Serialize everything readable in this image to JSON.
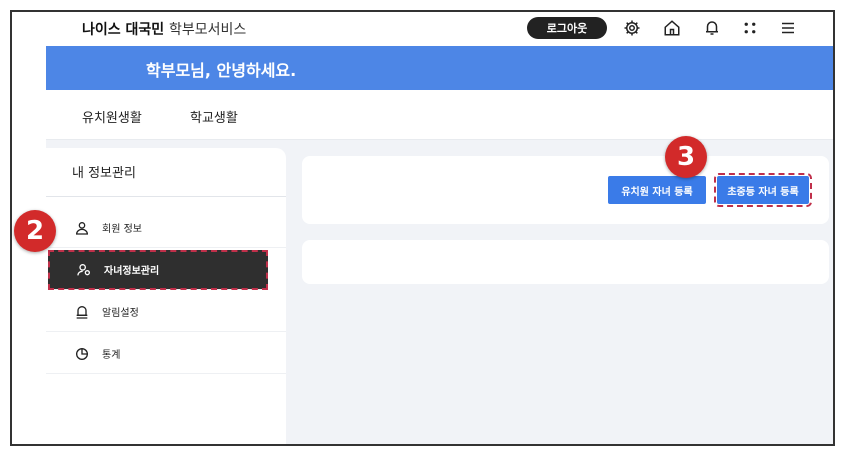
{
  "header": {
    "brand_bold": "나이스 대국민",
    "brand_sub": "학부모서비스",
    "logout_label": "로그아웃",
    "icons": [
      "gear-icon",
      "home-icon",
      "bell-icon",
      "grid-icon",
      "menu-icon"
    ]
  },
  "banner": {
    "greeting": "학부모님, 안녕하세요."
  },
  "tabs": [
    {
      "label": "유치원생활"
    },
    {
      "label": "학교생활"
    }
  ],
  "sidebar": {
    "title": "내 정보관리",
    "items": [
      {
        "label": "회원 정보",
        "icon": "user-icon"
      },
      {
        "label": "자녀정보관리",
        "icon": "child-user-icon",
        "active": true
      },
      {
        "label": "알림설정",
        "icon": "bell-icon"
      },
      {
        "label": "통계",
        "icon": "pie-chart-icon"
      }
    ]
  },
  "actions": {
    "kinder_register": "유치원 자녀 등록",
    "school_register": "초중등 자녀 등록"
  },
  "annotations": {
    "step2": "2",
    "step3": "3"
  },
  "colors": {
    "banner": "#4d86e6",
    "button": "#3a7be8",
    "active_menu": "#2f2f2f",
    "badge": "#d22a2a"
  }
}
